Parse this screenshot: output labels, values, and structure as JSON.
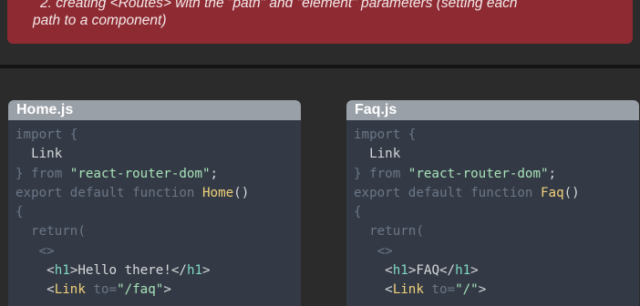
{
  "banner": {
    "line1": "2. creating <Routes> with the \"path\" and \"element\" parameters (setting each",
    "line2": "path to a component)"
  },
  "panels": [
    {
      "title": "Home.js",
      "code": {
        "l1_kw": "import {",
        "l2_txt": "  Link",
        "l3_kw": "} from ",
        "l3_str": "\"react-router-dom\"",
        "l3_txt": ";",
        "l4_kw": "export default function ",
        "l4_fn": "Home",
        "l4_txt": "()",
        "l5_kw": "{",
        "l6_kw": "  return(",
        "l7_kw": "   <>",
        "l8_pre": "    <",
        "l8_tag": "h1",
        "l8_mid": ">",
        "l8_txt": "Hello there!",
        "l8_close": "</",
        "l8_tag2": "h1",
        "l8_end": ">",
        "l9_pre": "    <",
        "l9_fn": "Link",
        "l9_attr": " to=",
        "l9_str": "\"/faq\"",
        "l9_end": ">"
      }
    },
    {
      "title": "Faq.js",
      "code": {
        "l1_kw": "import {",
        "l2_txt": "  Link",
        "l3_kw": "} from ",
        "l3_str": "\"react-router-dom\"",
        "l3_txt": ";",
        "l4_kw": "export default function ",
        "l4_fn": "Faq",
        "l4_txt": "()",
        "l5_kw": "{",
        "l6_kw": "  return(",
        "l7_kw": "   <>",
        "l8_pre": "    <",
        "l8_tag": "h1",
        "l8_mid": ">",
        "l8_txt": "FAQ",
        "l8_close": "</",
        "l8_tag2": "h1",
        "l8_end": ">",
        "l9_pre": "    <",
        "l9_fn": "Link",
        "l9_attr": " to=",
        "l9_str": "\"/\"",
        "l9_end": ">"
      }
    }
  ]
}
